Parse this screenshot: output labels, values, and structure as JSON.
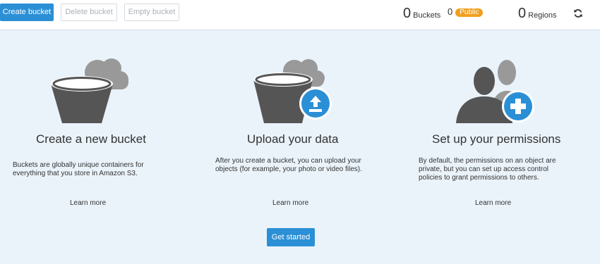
{
  "toolbar": {
    "create_bucket": "Create bucket",
    "delete_bucket": "Delete bucket",
    "empty_bucket": "Empty bucket",
    "buckets_count": "0",
    "buckets_label": "Buckets",
    "public_count": "0",
    "public_label": "Public",
    "regions_count": "0",
    "regions_label": "Regions",
    "refresh_icon": "refresh-icon"
  },
  "cards": [
    {
      "icon": "bucket-cloud-icon",
      "title": "Create a new bucket",
      "description": "Buckets are globally unique containers for everything that you store in Amazon S3.",
      "link": "Learn more"
    },
    {
      "icon": "bucket-upload-icon",
      "title": "Upload your data",
      "description": "After you create a bucket, you can upload your objects (for example, your photo or video files).",
      "link": "Learn more"
    },
    {
      "icon": "users-add-icon",
      "title": "Set up your permissions",
      "description": "By default, the permissions on an object are private, but you can set up access control policies to grant permissions to others.",
      "link": "Learn more"
    }
  ],
  "get_started": "Get started",
  "colors": {
    "primary": "#2b8fd6",
    "badge": "#f0a01e",
    "panel_bg": "#eaf3fa",
    "icon_dark": "#555555",
    "icon_light": "#999999"
  }
}
